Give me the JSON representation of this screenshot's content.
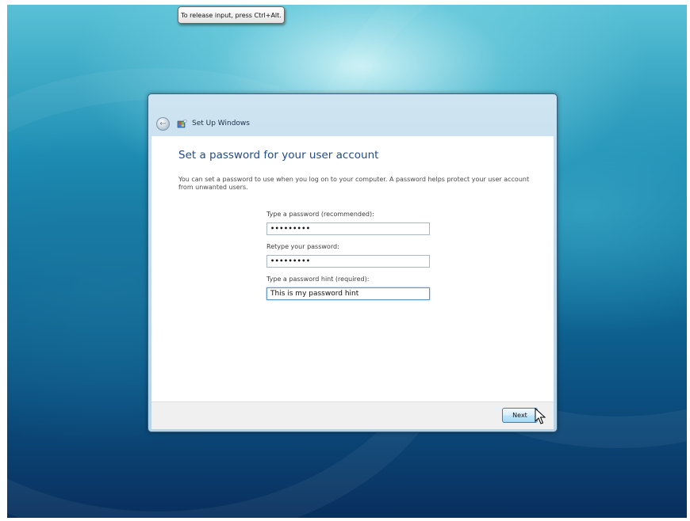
{
  "tooltip": {
    "text": "To release input, press Ctrl+Alt."
  },
  "window": {
    "title": "Set Up Windows",
    "back_icon": "back-arrow-icon",
    "app_icon": "setup-windows-icon"
  },
  "page": {
    "heading": "Set a password for your user account",
    "description": "You can set a password to use when you log on to your computer. A password helps protect your user account from unwanted users.",
    "password_label": "Type a password (recommended):",
    "password_value": "•••••••••",
    "retype_label": "Retype your password:",
    "retype_value": "•••••••••",
    "hint_label": "Type a password hint (required):",
    "hint_value": "This is my password hint"
  },
  "footer": {
    "next_label": "Next"
  },
  "colors": {
    "heading": "#1f4a8c",
    "accent_border": "#3c7fb1",
    "window_frame": "#b7d3e6"
  }
}
